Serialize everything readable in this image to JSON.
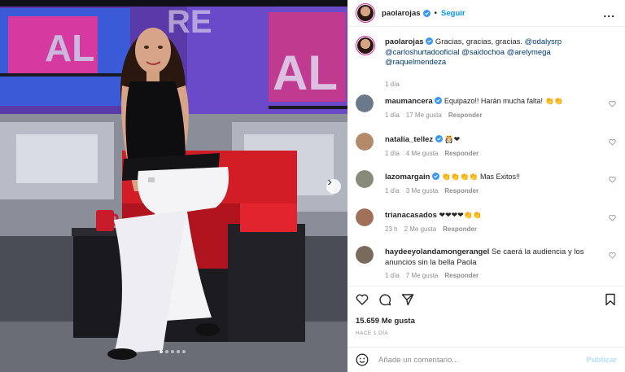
{
  "post": {
    "author": "paolarojas",
    "follow_label": "Seguir",
    "more_label": "...",
    "caption_prefix": "Gracias, gracias, gracias.",
    "caption_mentions": "@odalysrp @carloshurtadooficial @saidochoa @arelymega @raquelmendeza",
    "caption_time": "1 día",
    "likes": "15.659 Me gusta",
    "posted": "HACE 1 DÍA",
    "image_alt": "Mujer sentada en un sillón rojo en un set de televisión",
    "carousel_dots": 5,
    "carousel_active": 0
  },
  "comments": [
    {
      "user": "maumancera",
      "verified": true,
      "text": "Equipazo!! Harán mucha falta! 👏👏",
      "time": "1 día",
      "likes": "17 Me gusta",
      "reply": "Responder",
      "avatar_color": "#6b7a8a"
    },
    {
      "user": "natalia_tellez",
      "verified": true,
      "text": "👸🏻❤",
      "time": "1 día",
      "likes": "4 Me gusta",
      "reply": "Responder",
      "avatar_color": "#b58a6a"
    },
    {
      "user": "lazomargain",
      "verified": true,
      "text": "👏👏👏👏 Mas Exitos!!",
      "time": "1 día",
      "likes": "3 Me gusta",
      "reply": "Responder",
      "avatar_color": "#8a8a7a"
    },
    {
      "user": "trianacasados",
      "verified": false,
      "text": "❤❤❤❤👏👏",
      "time": "23 h",
      "likes": "2 Me gusta",
      "reply": "Responder",
      "avatar_color": "#a07058"
    },
    {
      "user": "haydeeyolandamongerangel",
      "verified": false,
      "text": "Se caerá la audiencia y los anuncios sin la bella Paola",
      "time": "1 día",
      "likes": "7 Me gusta",
      "reply": "Responder",
      "avatar_color": "#7a6a5a"
    }
  ],
  "composer": {
    "placeholder": "Añade un comentario...",
    "publish_label": "Publicar"
  },
  "icons": {
    "like": "heart-icon",
    "comment": "comment-icon",
    "share": "send-icon",
    "save": "bookmark-icon",
    "emoji": "smiley-icon"
  },
  "colors": {
    "link": "#0095f6",
    "verified": "#3897f0",
    "publish_disabled": "#b2dffc"
  }
}
